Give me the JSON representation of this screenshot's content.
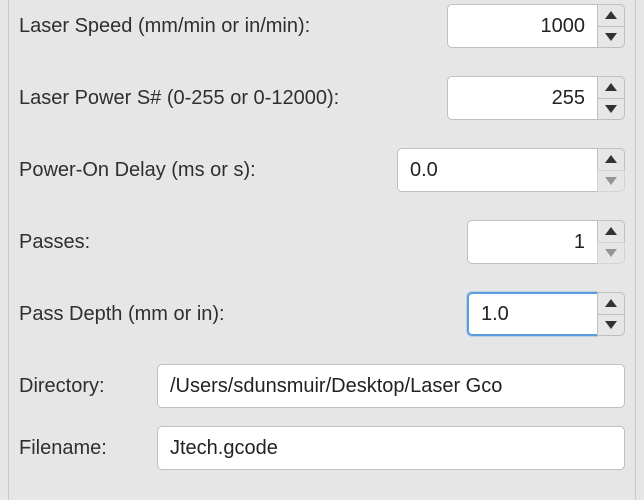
{
  "fields": {
    "laser_speed": {
      "label": "Laser Speed (mm/min or in/min):",
      "value": "1000"
    },
    "laser_power": {
      "label": "Laser Power S# (0-255 or 0-12000):",
      "value": "255"
    },
    "power_on_delay": {
      "label": "Power-On Delay (ms or s):",
      "value": "0.0"
    },
    "passes": {
      "label": "Passes:",
      "value": "1"
    },
    "pass_depth": {
      "label": "Pass Depth (mm or in):",
      "value": "1.0"
    },
    "directory": {
      "label": "Directory:",
      "value": "/Users/sdunsmuir/Desktop/Laser Gco"
    },
    "filename": {
      "label": "Filename:",
      "value": "Jtech.gcode"
    }
  }
}
